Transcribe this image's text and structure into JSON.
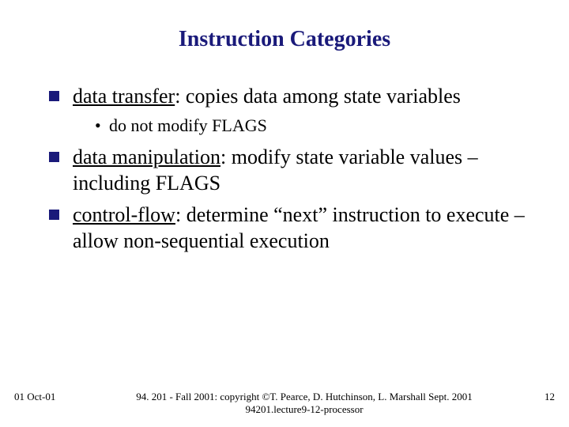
{
  "title": "Instruction Categories",
  "bullets": {
    "b1": {
      "pre": "",
      "term": "data transfer",
      "post": ": copies data among state variables"
    },
    "b1sub": "do not modify FLAGS",
    "b2": {
      "term": "data manipulation",
      "post": ": modify state variable values – including FLAGS"
    },
    "b3": {
      "term": "control-flow",
      "post": ": determine “next” instruction to execute – allow non-sequential execution"
    }
  },
  "footer": {
    "date": "01 Oct-01",
    "center_line1": "94. 201 - Fall 2001: copyright ©T. Pearce, D. Hutchinson, L. Marshall Sept. 2001",
    "center_line2": "94201.lecture9-12-processor",
    "page": "12"
  }
}
